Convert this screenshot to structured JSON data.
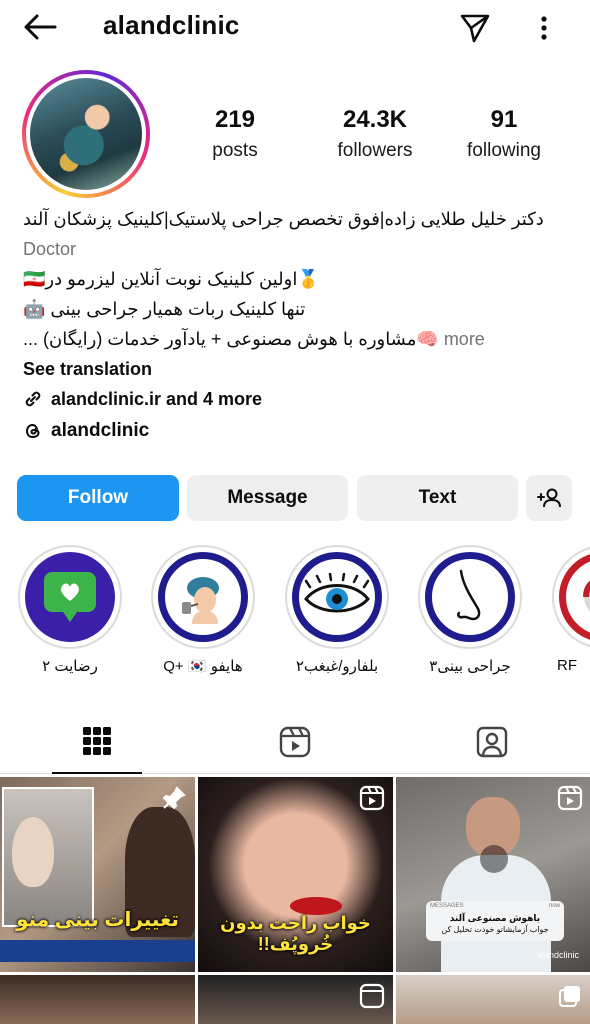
{
  "header": {
    "username": "alandclinic",
    "back_icon": "arrow-left-icon",
    "send_icon": "paper-plane-icon",
    "more_icon": "vertical-dots-icon"
  },
  "profile": {
    "stats": {
      "posts_value": "219",
      "posts_label": "posts",
      "followers_value": "24.3K",
      "followers_label": "followers",
      "following_value": "91",
      "following_label": "following"
    },
    "bio": {
      "name_line": "دکتر خلیل طلایی زاده|فوق تخصص جراحی پلاستیک|کلینیک پزشکان آلند",
      "category": "Doctor",
      "line1": "🥇اولین کلینیک نوبت آنلاین لیزرمو در🇮🇷",
      "line2": "تنها کلینیک ربات همیار جراحی بینی 🤖",
      "line3": "🧠مشاوره با هوش مصنوعی + یادآور خدمات (رایگان) ...",
      "more_label": "more",
      "see_translation": "See translation",
      "link_text": "alandclinic.ir and 4 more",
      "threads_handle": "alandclinic"
    }
  },
  "actions": {
    "follow_label": "Follow",
    "message_label": "Message",
    "text_label": "Text",
    "follow_color": "#1c96f2"
  },
  "highlights": [
    {
      "label": "رضایت ۲"
    },
    {
      "label": "هایفو Q+ 🇰🇷"
    },
    {
      "label": "بلفارو/غبغب۲"
    },
    {
      "label": "جراحی بینی۳"
    },
    {
      "label": "RF"
    }
  ],
  "posts": [
    {
      "caption": "تغییرات بینی منو ببین"
    },
    {
      "caption": "خواب راحت بدون خُروپُف!!"
    },
    {
      "caption_line1": "باهوش مصنوعی آلند",
      "caption_line2": "جواب آزمایشاتو خودت تحلیل کن",
      "message_app": "MESSAGES",
      "message_time": "now",
      "handle": "alandclinic"
    }
  ]
}
